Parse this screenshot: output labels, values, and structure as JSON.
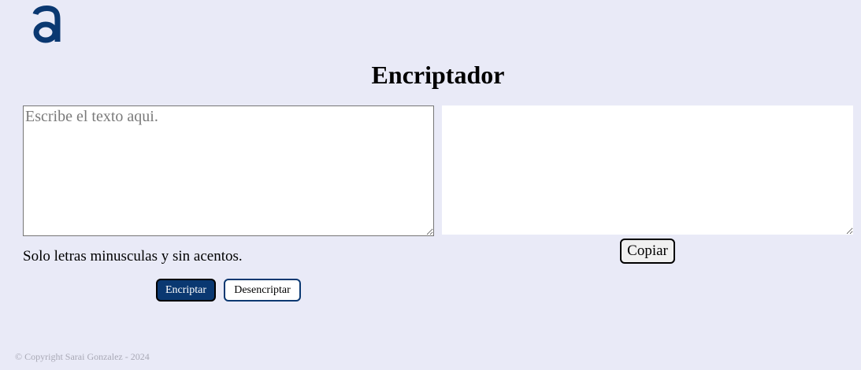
{
  "header": {
    "logo_icon": "alura-a-logo-icon",
    "title": "Encriptador"
  },
  "input": {
    "placeholder": "Escribe el texto aqui.",
    "value": ""
  },
  "output": {
    "value": ""
  },
  "hint": "Solo letras minusculas y sin acentos.",
  "buttons": {
    "encrypt": "Encriptar",
    "decrypt": "Desencriptar",
    "copy": "Copiar"
  },
  "footer": {
    "copyright": "© Copyright Sarai Gonzalez - 2024"
  },
  "colors": {
    "background": "#e9eaf7",
    "primary": "#0a3871",
    "footer_text": "#a9a9b6"
  }
}
